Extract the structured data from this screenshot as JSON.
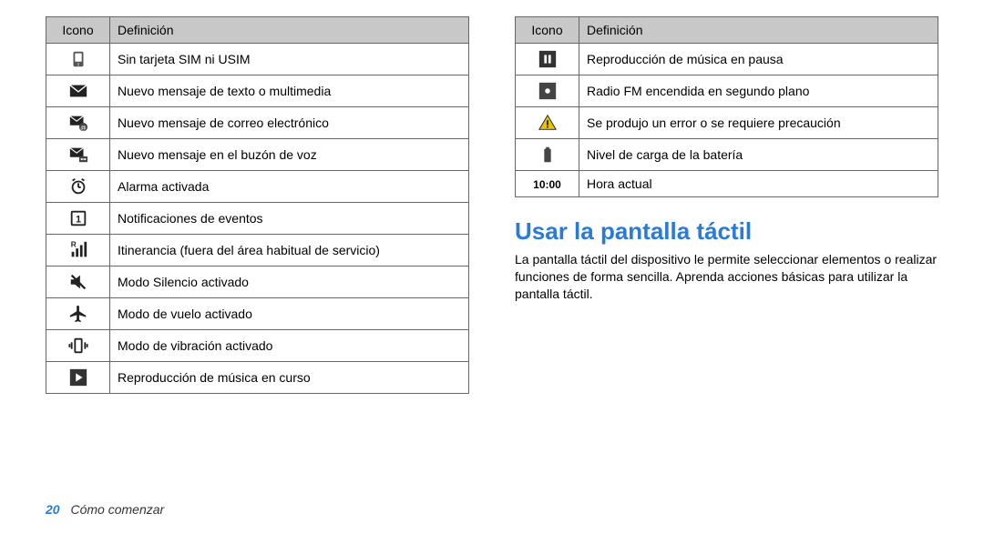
{
  "table_left": {
    "header_icon": "Icono",
    "header_def": "Definición",
    "rows": [
      {
        "icon": "sim",
        "def": "Sin tarjeta SIM ni USIM"
      },
      {
        "icon": "envelope",
        "def": "Nuevo mensaje de texto o multimedia"
      },
      {
        "icon": "email",
        "def": "Nuevo mensaje de correo electrónico"
      },
      {
        "icon": "voicemail",
        "def": "Nuevo mensaje en el buzón de voz"
      },
      {
        "icon": "alarm",
        "def": "Alarma activada"
      },
      {
        "icon": "event",
        "def": "Notificaciones de eventos"
      },
      {
        "icon": "roaming",
        "def": "Itinerancia (fuera del área habitual de servicio)"
      },
      {
        "icon": "silent",
        "def": "Modo Silencio activado"
      },
      {
        "icon": "airplane",
        "def": "Modo de vuelo activado"
      },
      {
        "icon": "vibrate",
        "def": "Modo de vibración activado"
      },
      {
        "icon": "play",
        "def": "Reproducción de música en curso"
      }
    ]
  },
  "table_right": {
    "header_icon": "Icono",
    "header_def": "Definición",
    "rows": [
      {
        "icon": "pause",
        "def": "Reproducción de música en pausa"
      },
      {
        "icon": "radio",
        "def": "Radio FM encendida en segundo plano"
      },
      {
        "icon": "warning",
        "def": "Se produjo un error o se requiere precaución"
      },
      {
        "icon": "battery",
        "def": "Nivel de carga de la batería"
      },
      {
        "icon": "clock",
        "text": "10:00",
        "def": "Hora actual"
      }
    ]
  },
  "section_heading": "Usar la pantalla táctil",
  "section_body": "La pantalla táctil del dispositivo le permite seleccionar elementos o realizar funciones de forma sencilla. Aprenda acciones básicas para utilizar la pantalla táctil.",
  "footer": {
    "page_number": "20",
    "chapter": "Cómo comenzar"
  }
}
